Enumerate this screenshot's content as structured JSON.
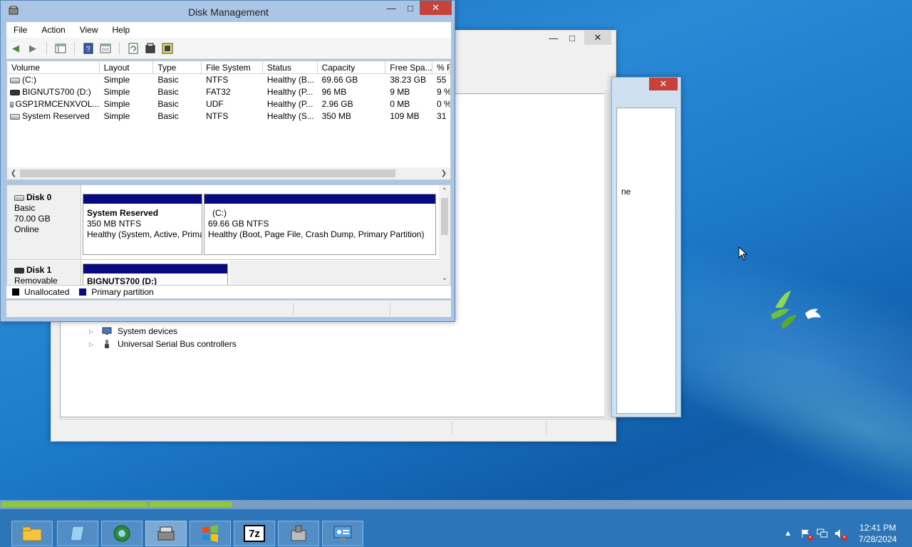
{
  "desktop": {
    "cursor_icon": "arrow-cursor-icon"
  },
  "device_manager": {
    "tree": [
      {
        "label": "System devices",
        "icon": "system-devices-icon"
      },
      {
        "label": "Universal Serial Bus controllers",
        "icon": "usb-icon"
      }
    ]
  },
  "dialog": {
    "fragment": "ne"
  },
  "disk_management": {
    "title": "Disk Management",
    "menu": [
      "File",
      "Action",
      "View",
      "Help"
    ],
    "toolbar_icons": [
      "back-icon",
      "forward-icon",
      "show-hide-console-tree-icon",
      "help-icon",
      "properties-icon",
      "refresh-icon",
      "rescan-icon",
      "export-list-icon"
    ],
    "columns": [
      "Volume",
      "Layout",
      "Type",
      "File System",
      "Status",
      "Capacity",
      "Free Spa...",
      "% F"
    ],
    "volumes": [
      {
        "volume": "(C:)",
        "layout": "Simple",
        "type": "Basic",
        "fs": "NTFS",
        "status": "Healthy (B...",
        "capacity": "69.66 GB",
        "free": "38.23 GB",
        "pct": "55"
      },
      {
        "volume": "BIGNUTS700 (D:)",
        "layout": "Simple",
        "type": "Basic",
        "fs": "FAT32",
        "status": "Healthy (P...",
        "capacity": "96 MB",
        "free": "9 MB",
        "pct": "9 %"
      },
      {
        "volume": "GSP1RMCENXVOL...",
        "layout": "Simple",
        "type": "Basic",
        "fs": "UDF",
        "status": "Healthy (P...",
        "capacity": "2.96 GB",
        "free": "0 MB",
        "pct": "0 %"
      },
      {
        "volume": "System Reserved",
        "layout": "Simple",
        "type": "Basic",
        "fs": "NTFS",
        "status": "Healthy (S...",
        "capacity": "350 MB",
        "free": "109 MB",
        "pct": "31"
      }
    ],
    "disks": [
      {
        "name": "Disk 0",
        "kind": "Basic",
        "size": "70.00 GB",
        "state": "Online",
        "partitions": [
          {
            "title": "System Reserved",
            "size": "350 MB NTFS",
            "status": "Healthy (System, Active, Primary Partition)"
          },
          {
            "title": "(C:)",
            "size": "69.66 GB NTFS",
            "status": "Healthy (Boot, Page File, Crash Dump, Primary Partition)"
          }
        ]
      },
      {
        "name": "Disk 1",
        "kind": "Removable",
        "partitions": [
          {
            "title": "BIGNUTS700  (D:)"
          }
        ]
      }
    ],
    "legend": [
      {
        "label": "Unallocated",
        "color": "#000000"
      },
      {
        "label": "Primary partition",
        "color": "#0a0a80"
      }
    ]
  },
  "taskbar": {
    "buttons": [
      "file-explorer-icon",
      "notepad-icon",
      "browser-icon",
      "disk-management-icon",
      "windows-start-icon",
      "7zip-icon",
      "installer-icon",
      "control-panel-icon"
    ],
    "sevenzip_label": "7z",
    "clock_time": "12:41 PM",
    "clock_date": "7/28/2024",
    "tray_icons": [
      "show-hidden-icons-icon",
      "action-center-icon",
      "network-icon",
      "volume-muted-icon"
    ],
    "progress": [
      0.16,
      0.09
    ]
  },
  "colors": {
    "primary_partition": "#0a0a80",
    "close_button": "#c7423a",
    "taskbar": "#2c75b9",
    "progress": "#8dc63f"
  }
}
